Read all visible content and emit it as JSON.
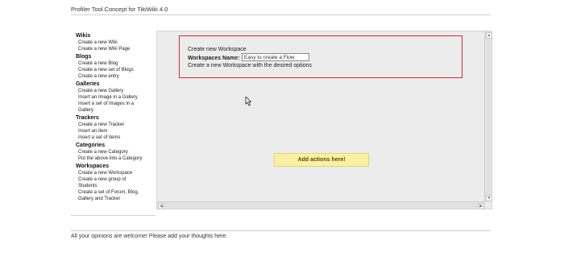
{
  "page_title": "Profiler Tool Concept for TikiWiki 4.0",
  "sidebar": {
    "sections": [
      {
        "head": "Wikis",
        "items": [
          "Create a new Wiki",
          "Create a new Wiki Page"
        ]
      },
      {
        "head": "Blogs",
        "items": [
          "Create a new Blog",
          "Create a new set of Blogs",
          "Create a new entry"
        ]
      },
      {
        "head": "Galleries",
        "items": [
          "Create a new Gallery",
          "Insert an Image in a Gallery",
          "Insert a set of Images in a",
          "Gallery"
        ]
      },
      {
        "head": "Trackers",
        "items": [
          "Create a new Tracker",
          "Insert an item",
          "Insert a set of items"
        ]
      },
      {
        "head": "Categories",
        "items": [
          "Create a new Category",
          "Put the above into a Category"
        ]
      },
      {
        "head": "Workspaces",
        "items": [
          "Create a new Workspace",
          "Create a new group of",
          "Students",
          "Create a set of Forum, Blog,",
          "Gallery and Tracker"
        ]
      }
    ]
  },
  "workspace_form": {
    "title": "Create new Workspace",
    "name_label": "Workspaces Name:",
    "name_value": "Easy to create a Flow",
    "description": "Create a new Workspace with the desired options"
  },
  "actions_button": "Add actions here!",
  "footer": "All your opinions are welcome! Please add your thoughts here:",
  "colors": {
    "box_border": "#d9263b",
    "actions_bg": "#fbf0a4",
    "canvas_bg": "#ececec"
  }
}
